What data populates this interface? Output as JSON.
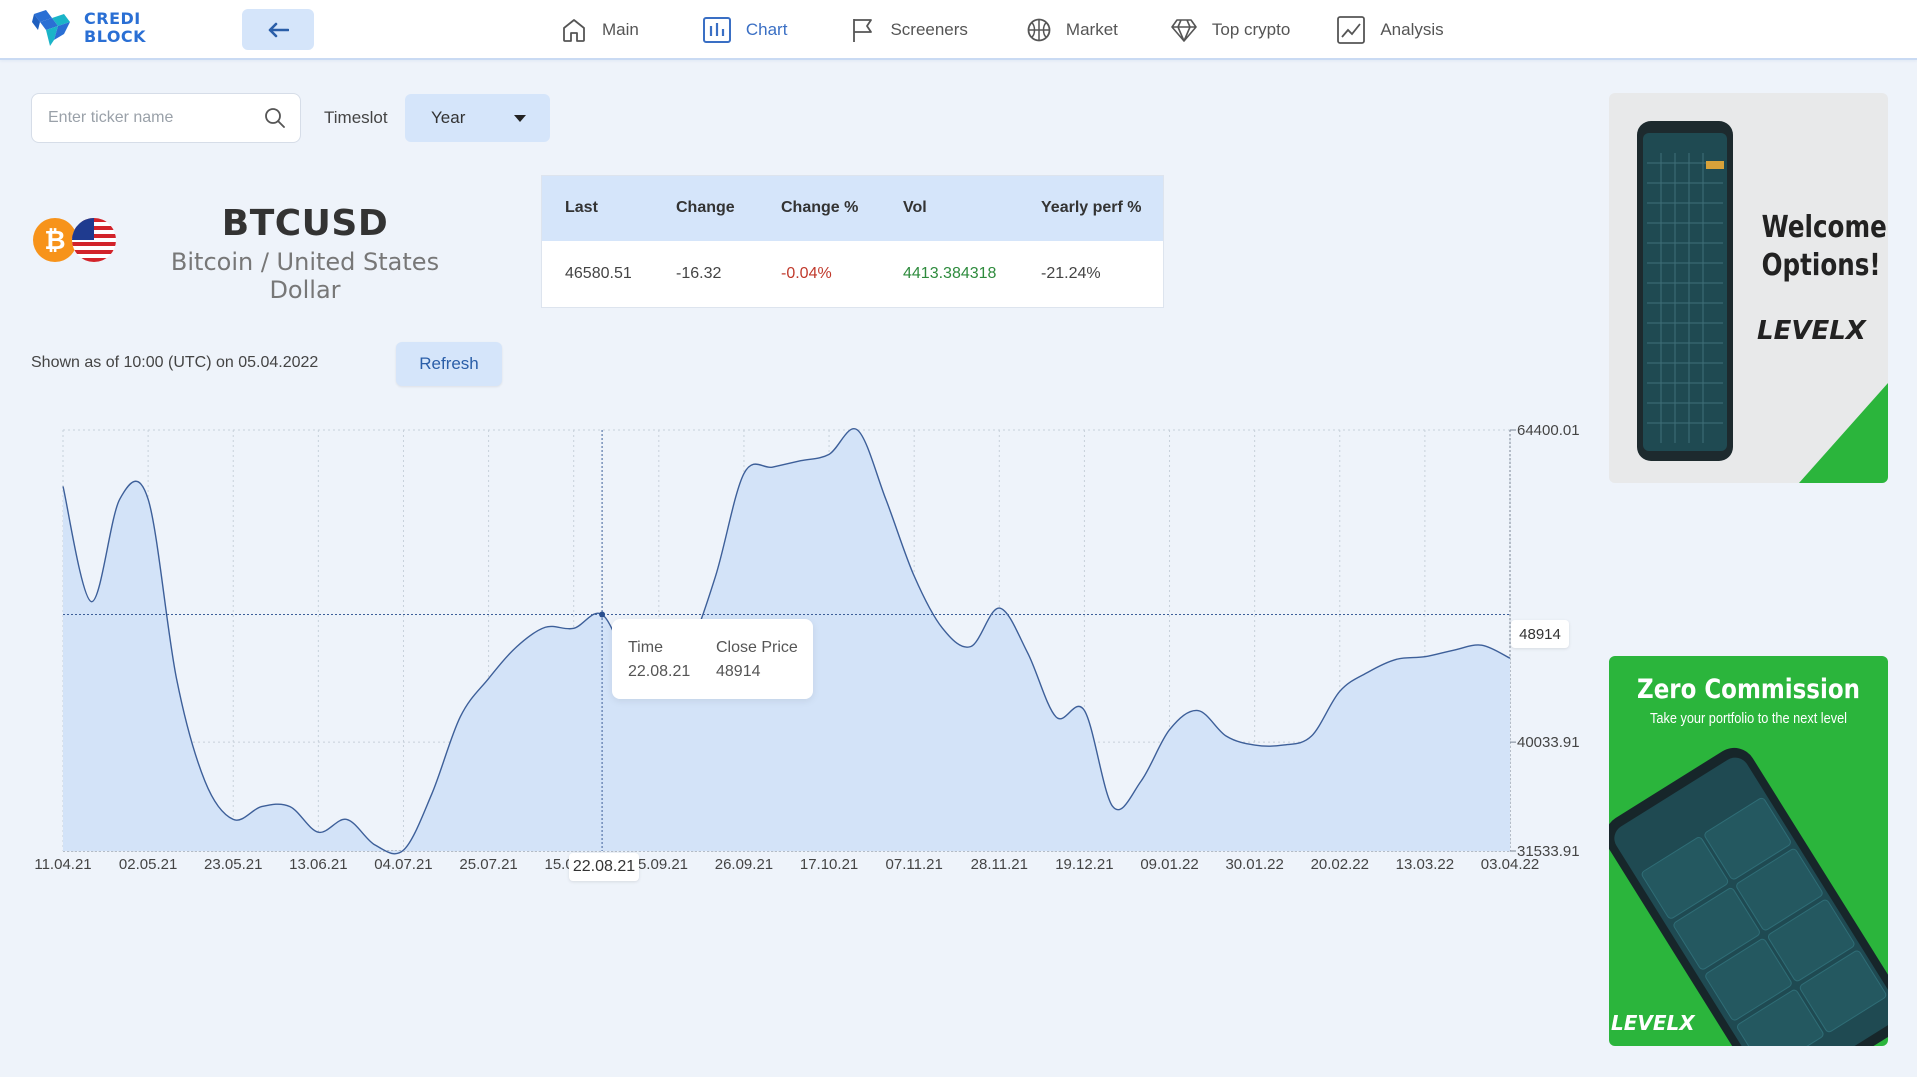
{
  "brand": {
    "line1": "CREDI",
    "line2": "BLOCK"
  },
  "nav": {
    "back_label": "←",
    "items": [
      {
        "label": "Main",
        "icon": "home-icon"
      },
      {
        "label": "Chart",
        "icon": "bar-chart-icon",
        "active": true
      },
      {
        "label": "Screeners",
        "icon": "flag-icon"
      },
      {
        "label": "Market",
        "icon": "basketball-icon"
      },
      {
        "label": "Top crypto",
        "icon": "diamond-icon"
      },
      {
        "label": "Analysis",
        "icon": "line-chart-icon"
      }
    ]
  },
  "controls": {
    "search_placeholder": "Enter ticker name",
    "timeslot_label": "Timeslot",
    "timeslot_value": "Year"
  },
  "ticker": {
    "symbol": "BTCUSD",
    "name": "Bitcoin / United States Dollar"
  },
  "stats": {
    "headers": [
      "Last",
      "Change",
      "Change %",
      "Vol",
      "Yearly perf %"
    ],
    "values": [
      "46580.51",
      "-16.32",
      "-0.04%",
      "4413.384318",
      "-21.24%"
    ]
  },
  "status": {
    "shown_as_of": "Shown as of 10:00 (UTC) on 05.04.2022",
    "refresh_label": "Refresh"
  },
  "tooltip": {
    "time_label": "Time",
    "price_label": "Close Price",
    "time_value": "22.08.21",
    "price_value": "48914"
  },
  "crosshair": {
    "x_label": "22.08.21",
    "y_label": "48914"
  },
  "ads": {
    "ad1_title_line1": "Welcome",
    "ad1_title_line2": "Options!",
    "ad1_brand": "LEVELX",
    "ad2_title": "Zero Commission",
    "ad2_subtitle": "Take your portfolio to the next level",
    "ad2_brand": "LEVELX"
  },
  "colors": {
    "accent": "#3a6fc4",
    "line": "#3d5f99",
    "fill": "#d3e3f8",
    "ad_green": "#2bb53c"
  },
  "chart_data": {
    "type": "area",
    "title": "",
    "xlabel": "",
    "ylabel": "",
    "x_ticks": [
      "11.04.21",
      "02.05.21",
      "23.05.21",
      "13.06.21",
      "04.07.21",
      "25.07.21",
      "15.08.21",
      "05.09.21",
      "26.09.21",
      "17.10.21",
      "07.11.21",
      "28.11.21",
      "19.12.21",
      "09.01.22",
      "30.01.22",
      "20.02.22",
      "13.03.22",
      "03.04.22"
    ],
    "y_ticks": [
      "64400.01",
      "40033.91",
      "31533.91"
    ],
    "y_tick_values": [
      64400.01,
      40033.91,
      31533.91
    ],
    "ylim": [
      31533.91,
      64400.01
    ],
    "series": [
      {
        "name": "Close Price",
        "x": [
          "11.04.21",
          "18.04.21",
          "25.04.21",
          "02.05.21",
          "09.05.21",
          "16.05.21",
          "23.05.21",
          "30.05.21",
          "06.06.21",
          "13.06.21",
          "20.06.21",
          "27.06.21",
          "04.07.21",
          "11.07.21",
          "18.07.21",
          "25.07.21",
          "01.08.21",
          "08.08.21",
          "15.08.21",
          "22.08.21",
          "29.08.21",
          "05.09.21",
          "12.09.21",
          "19.09.21",
          "26.09.21",
          "03.10.21",
          "10.10.21",
          "17.10.21",
          "24.10.21",
          "31.10.21",
          "07.11.21",
          "14.11.21",
          "21.11.21",
          "28.11.21",
          "05.12.21",
          "12.12.21",
          "19.12.21",
          "26.12.21",
          "02.01.22",
          "09.01.22",
          "16.01.22",
          "23.01.22",
          "30.01.22",
          "06.02.22",
          "13.02.22",
          "20.02.22",
          "27.02.22",
          "06.03.22",
          "13.03.22",
          "20.03.22",
          "27.03.22",
          "03.04.22"
        ],
        "values": [
          60000,
          51000,
          59000,
          59000,
          45000,
          37000,
          34000,
          35000,
          35000,
          33000,
          34000,
          32000,
          31600,
          36000,
          42000,
          45000,
          47500,
          49000,
          48914,
          50000,
          46000,
          44500,
          47000,
          53000,
          61000,
          61500,
          62000,
          62500,
          64400,
          59000,
          53000,
          48914,
          47500,
          50500,
          47000,
          42000,
          42500,
          35000,
          37000,
          41000,
          42500,
          40500,
          39800,
          39800,
          40500,
          44000,
          45500,
          46500,
          46700,
          47200,
          47600,
          46580.51
        ]
      }
    ]
  }
}
